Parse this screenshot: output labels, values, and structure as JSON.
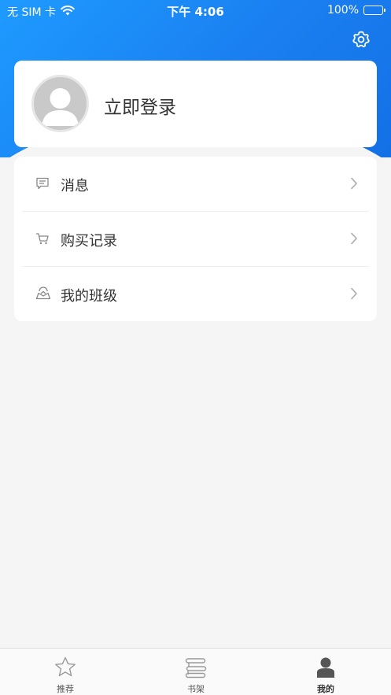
{
  "status_bar": {
    "carrier": "无 SIM 卡",
    "time": "下午 4:06",
    "battery": "100%"
  },
  "header": {
    "settings_icon": "gear-icon",
    "accent_color": "#1a7ff0"
  },
  "profile": {
    "login_label": "立即登录",
    "avatar_icon": "default-avatar-icon"
  },
  "menu": {
    "items": [
      {
        "label": "消息",
        "icon": "message-icon"
      },
      {
        "label": "购买记录",
        "icon": "cart-icon"
      },
      {
        "label": "我的班级",
        "icon": "class-icon"
      }
    ]
  },
  "tabbar": {
    "tabs": [
      {
        "label": "推荐",
        "icon": "star-icon",
        "active": false
      },
      {
        "label": "书架",
        "icon": "bookshelf-icon",
        "active": false
      },
      {
        "label": "我的",
        "icon": "person-icon",
        "active": true
      }
    ]
  }
}
